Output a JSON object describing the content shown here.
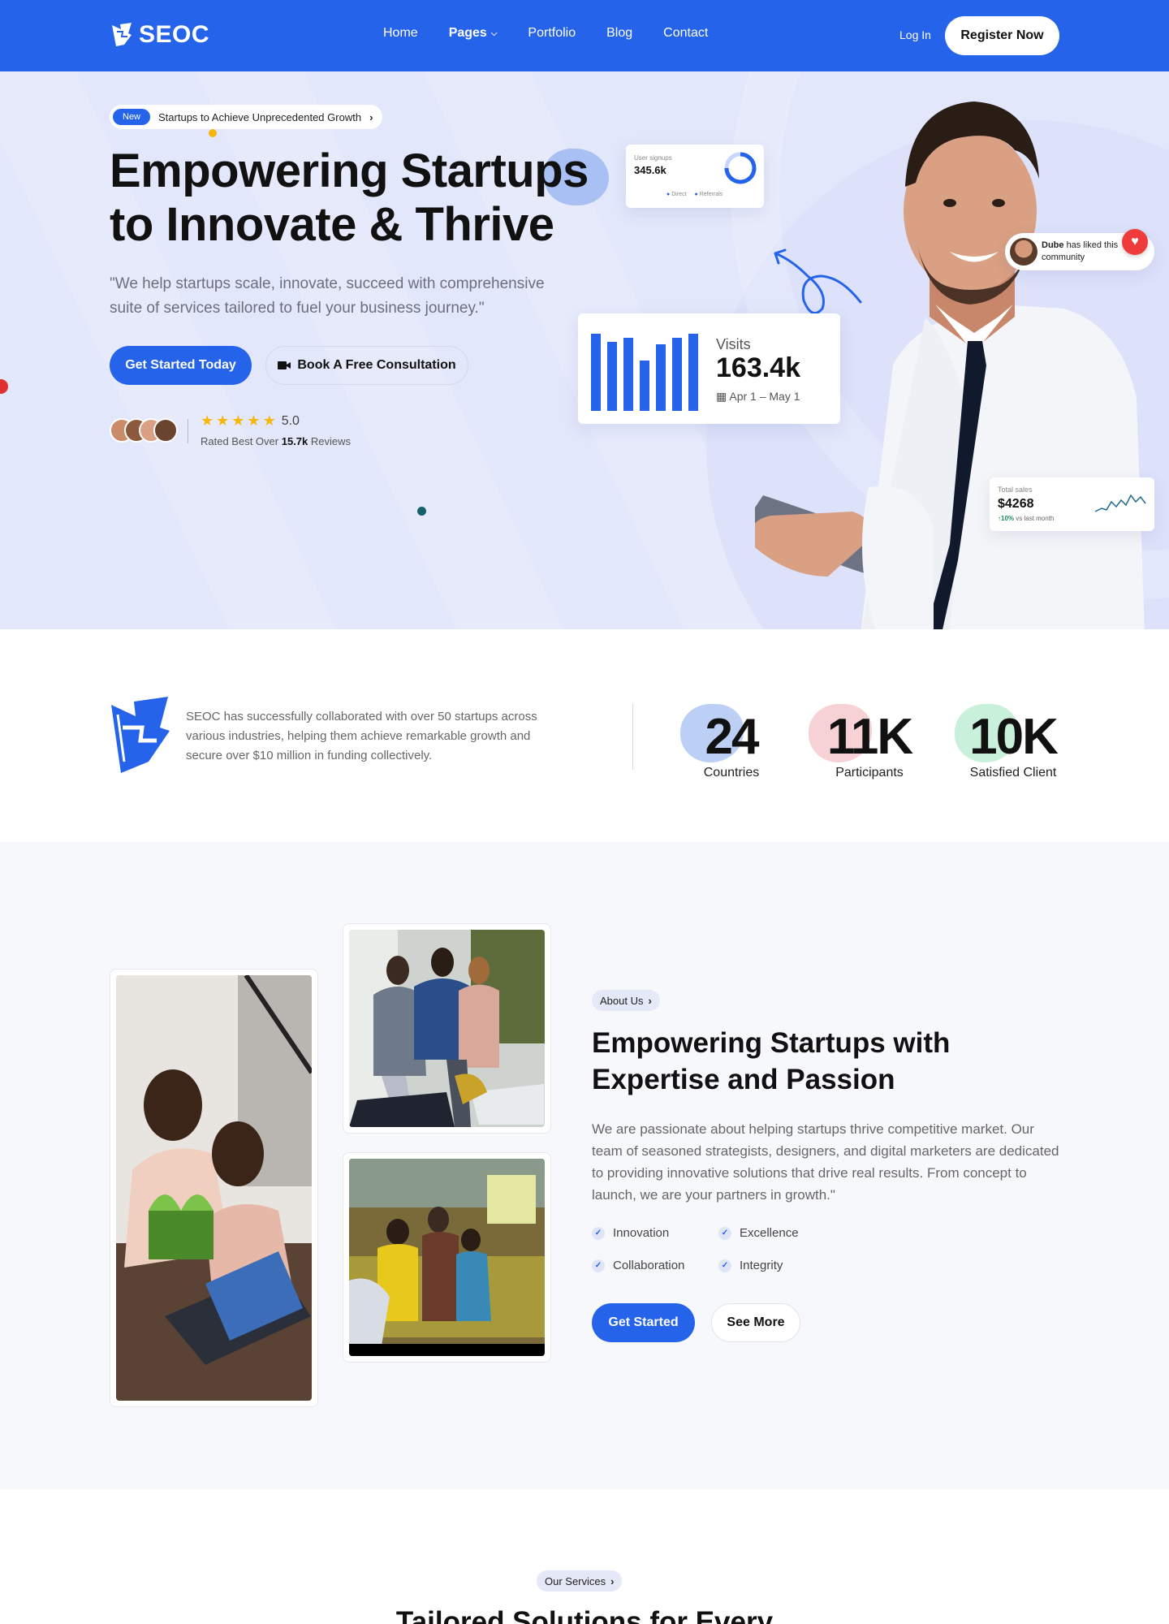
{
  "brand": {
    "name": "SEOC",
    "primary": "#2563eb"
  },
  "nav": {
    "links": [
      "Home",
      "Pages",
      "Portfolio",
      "Blog",
      "Contact"
    ],
    "login": "Log In",
    "register": "Register Now"
  },
  "hero": {
    "badge_new": "New",
    "badge_text": "Startups to Achieve Unprecedented Growth",
    "title": "Empowering Startups to Innovate & Thrive",
    "subtitle": "\"We help startups scale, innovate, succeed with comprehensive suite of services tailored to fuel your business journey.\"",
    "cta_primary": "Get Started Today",
    "cta_secondary": "Book A Free Consultation",
    "rating": "5.0",
    "rated_prefix": "Rated Best Over",
    "rated_count": "15.7k",
    "rated_suffix": "Reviews",
    "signups_label": "User signups",
    "signups_value": "345.6k",
    "signups_legend": [
      "Direct",
      "Referrals"
    ],
    "visits_label": "Visits",
    "visits_value": "163.4k",
    "visits_date": "Apr 1 – May 1",
    "liked_name": "Dube",
    "liked_text": "has liked this community",
    "sales_label": "Total sales",
    "sales_value": "$4268",
    "sales_change": "10%",
    "sales_change_suffix": "vs last month",
    "visits_bars": [
      0.95,
      0.85,
      0.9,
      0.62,
      0.82,
      0.9,
      0.95
    ]
  },
  "stats": {
    "text": "SEOC has successfully collaborated with over 50 startups across various industries, helping them achieve remarkable growth and secure over $10 million in funding collectively.",
    "items": [
      {
        "value": "24",
        "label": "Countries"
      },
      {
        "value": "11K",
        "label": "Participants"
      },
      {
        "value": "10K",
        "label": "Satisfied Client"
      }
    ]
  },
  "about": {
    "badge": "About Us",
    "title": "Empowering Startups with Expertise and Passion",
    "text": "We are passionate about helping startups thrive competitive market. Our team of seasoned strategists, designers, and digital marketers are dedicated to providing innovative solutions that drive real results. From concept to launch, we are your partners in growth.\"",
    "features": [
      "Innovation",
      "Excellence",
      "Collaboration",
      "Integrity"
    ],
    "btn_primary": "Get Started",
    "btn_secondary": "See More"
  },
  "services": {
    "badge": "Our Services",
    "title": "Tailored Solutions for Every"
  }
}
